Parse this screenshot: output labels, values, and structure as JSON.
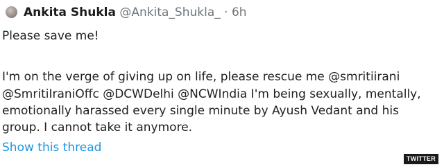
{
  "tweet": {
    "display_name": "Ankita Shukla",
    "handle": "@Ankita_Shukla_",
    "separator": "·",
    "time": "6h",
    "lines": [
      "Please save me!",
      "I'm on the verge of giving up on life, please rescue me @smritiirani",
      "@SmritiIraniOffc @DCWDelhi @NCWIndia I'm being sexually, mentally,",
      "emotionally harassed every single minute by Ayush Vedant and his",
      "group. I cannot take it anymore."
    ],
    "show_thread_label": "Show this thread"
  },
  "watermark": {
    "label": "TWITTER"
  },
  "colors": {
    "link": "#1b95e0",
    "muted": "#6e767d",
    "text": "#1f1f1f"
  }
}
